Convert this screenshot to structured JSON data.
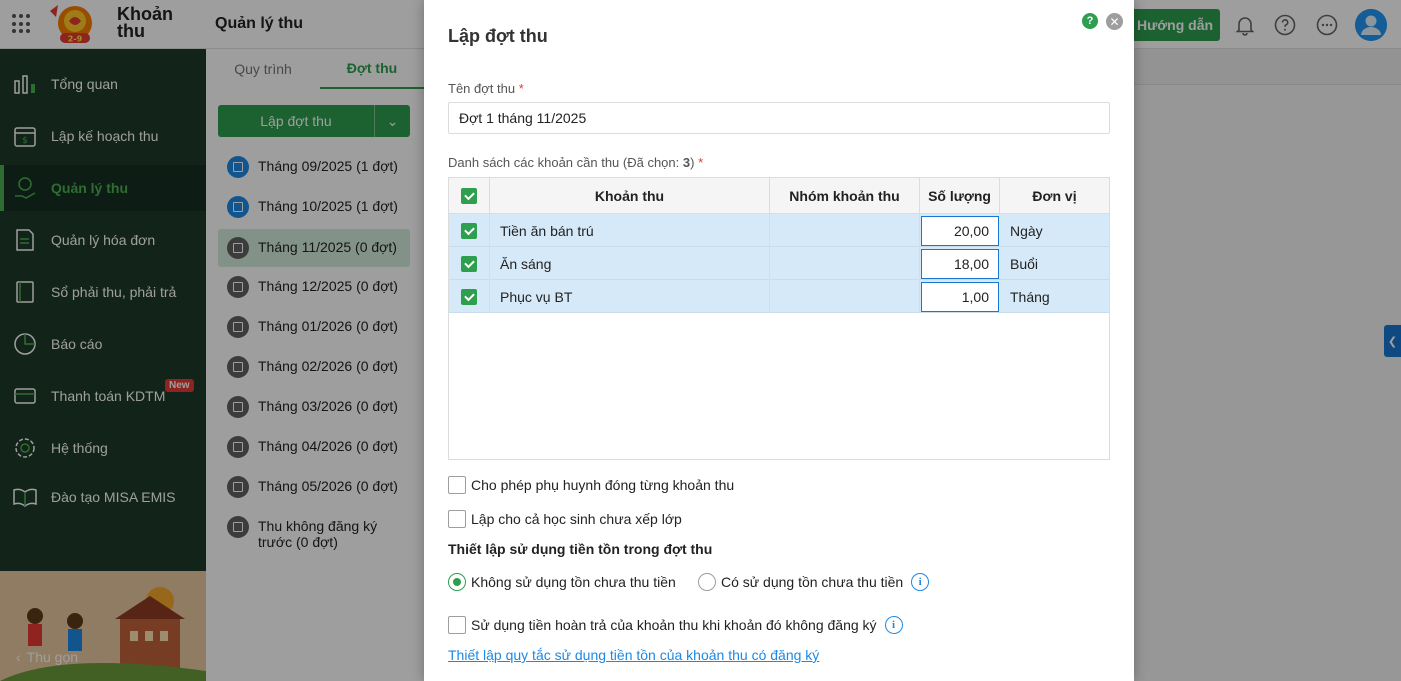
{
  "header": {
    "brand": "Khoản thu",
    "module_title": "Quản lý thu",
    "guide_label": "Hướng dẫn",
    "icons": [
      "apps-grid-icon",
      "bell-icon",
      "help-circle-icon",
      "more-icon",
      "avatar"
    ]
  },
  "sidebar": {
    "items": [
      {
        "label": "Tổng quan",
        "icon": "chart-bars-icon"
      },
      {
        "label": "Lập kế hoạch thu",
        "icon": "calendar-dollar-icon"
      },
      {
        "label": "Quản lý thu",
        "icon": "money-hand-icon",
        "active": true
      },
      {
        "label": "Quản lý hóa đơn",
        "icon": "invoice-icon"
      },
      {
        "label": "Sổ phải thu, phải trả",
        "icon": "ledger-book-icon"
      },
      {
        "label": "Báo cáo",
        "icon": "pie-chart-icon"
      },
      {
        "label": "Thanh toán KDTM",
        "icon": "card-icon",
        "badge": "New"
      },
      {
        "label": "Hệ thống",
        "icon": "gear-icon"
      },
      {
        "label": "Đào tạo MISA EMIS",
        "icon": "open-book-icon"
      }
    ],
    "collapse_label": "Thu gọn"
  },
  "subpanel": {
    "tabs": [
      "Quy trình",
      "Đợt thu"
    ],
    "active_tab": "Đợt thu",
    "create_button": "Lập đợt thu",
    "periods": [
      {
        "label": "Tháng 09/2025 (1 đợt)",
        "color": "#1e88e5"
      },
      {
        "label": "Tháng 10/2025 (1 đợt)",
        "color": "#1e88e5"
      },
      {
        "label": "Tháng 11/2025 (0 đợt)",
        "color": "#616161",
        "selected": true
      },
      {
        "label": "Tháng 12/2025 (0 đợt)",
        "color": "#616161"
      },
      {
        "label": "Tháng 01/2026 (0 đợt)",
        "color": "#616161"
      },
      {
        "label": "Tháng 02/2026 (0 đợt)",
        "color": "#616161"
      },
      {
        "label": "Tháng 03/2026 (0 đợt)",
        "color": "#616161"
      },
      {
        "label": "Tháng 04/2026 (0 đợt)",
        "color": "#616161"
      },
      {
        "label": "Tháng 05/2026 (0 đợt)",
        "color": "#616161"
      },
      {
        "label_line1": "Thu không đăng ký",
        "label_line2": "trước (0 đợt)",
        "color": "#616161"
      }
    ]
  },
  "dialog": {
    "title": "Lập đợt thu",
    "name_label": "Tên đợt thu",
    "required_mark": "*",
    "name_value": "Đợt 1 tháng 11/2025",
    "list_label_prefix": "Danh sách các khoản cần thu (Đã chọn: ",
    "list_selected_count": "3",
    "list_label_suffix": ")",
    "table": {
      "headers": [
        "Khoản thu",
        "Nhóm khoản thu",
        "Số lượng",
        "Đơn vị"
      ],
      "rows": [
        {
          "name": "Tiền ăn bán trú",
          "group": "",
          "quantity": "20,00",
          "unit": "Ngày",
          "checked": true
        },
        {
          "name": "Ăn sáng",
          "group": "",
          "quantity": "18,00",
          "unit": "Buổi",
          "checked": true
        },
        {
          "name": "Phục vụ BT",
          "group": "",
          "quantity": "1,00",
          "unit": "Tháng",
          "checked": true
        }
      ]
    },
    "option_allow_parent": "Cho phép phụ huynh đóng từng khoản thu",
    "option_unassigned_students": "Lập cho cả học sinh chưa xếp lớp",
    "section_title": "Thiết lập sử dụng tiền tồn trong đợt thu",
    "radio_no_use": "Không sử dụng tồn chưa thu tiền",
    "radio_use": "Có sử dụng tồn chưa thu tiền",
    "radio_selected": "no_use",
    "option_refund": "Sử dụng tiền hoàn trả của khoản thu khi khoản đó không đăng ký",
    "link_rules": "Thiết lập quy tắc sử dụng tiền tồn của khoản thu có đăng ký",
    "colors": {
      "primary": "#2e9e4f",
      "link": "#1e88e5",
      "row_highlight": "#d6e9f8"
    }
  }
}
